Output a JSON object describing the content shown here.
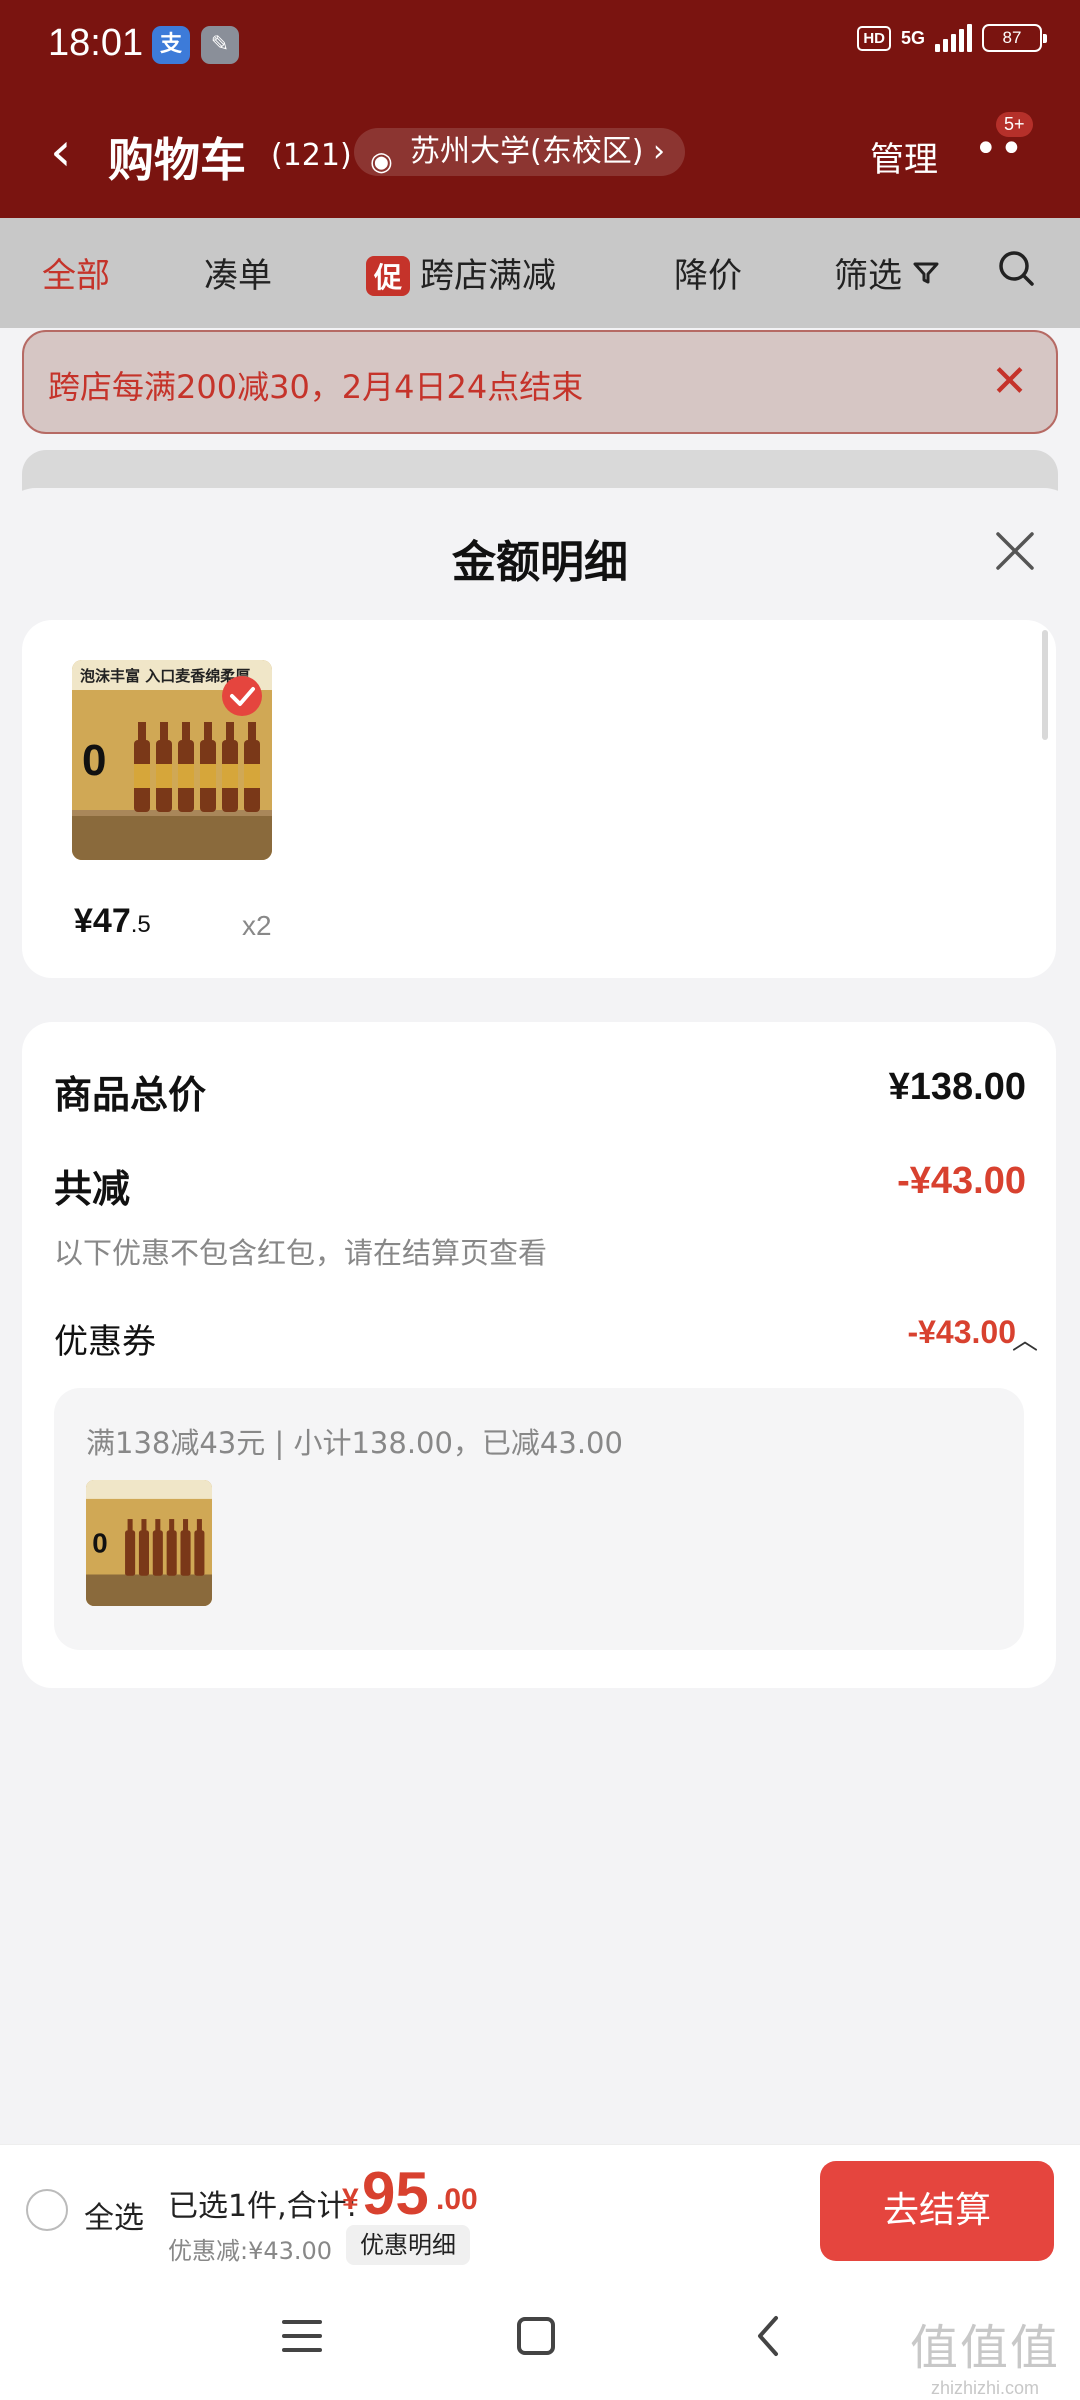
{
  "status_bar": {
    "time": "18:01",
    "network": "5G",
    "hd": "HD",
    "battery": "87"
  },
  "nav": {
    "title": "购物车",
    "count": "(121)",
    "address": "苏州大学(东校区)",
    "manage": "管理",
    "badge": "5+"
  },
  "tabs": [
    {
      "label": "全部"
    },
    {
      "label": "凑单"
    },
    {
      "label": "跨店满减",
      "badge": "促"
    },
    {
      "label": "降价"
    },
    {
      "label": "筛选"
    }
  ],
  "promo_banner": {
    "text": "跨店每满200减30，2月4日24点结束"
  },
  "sheet": {
    "title": "金额明细",
    "items": [
      {
        "image_caption": "泡沫丰富 入口麦香绵柔厚",
        "price_int": "¥47",
        "price_dec": ".5",
        "qty": "x2"
      }
    ],
    "summary": {
      "total_label": "商品总价",
      "total_value": "¥138.00",
      "reduce_label": "共减",
      "reduce_value": "-¥43.00",
      "reduce_note": "以下优惠不包含红包，请在结算页查看",
      "coupon_label": "优惠券",
      "coupon_value": "-¥43.00",
      "coupon_detail": "满138减43元 | 小计138.00，已减43.00"
    }
  },
  "checkout": {
    "select_all": "全选",
    "selected_text": "已选1件,合计:",
    "currency": "¥",
    "total_int": "95",
    "total_dec": ".00",
    "discount": "优惠减:¥43.00",
    "detail_button": "优惠明细",
    "checkout_button": "去结算"
  },
  "watermark": {
    "text": "zhizhizhi.com"
  },
  "colors": {
    "header": "#7a1410",
    "accent": "#d8412f",
    "checkout_button": "#e5453e"
  },
  "icons": [
    "back-chevron-icon",
    "eye-icon",
    "more-dots-icon",
    "filter-icon",
    "search-icon",
    "close-icon",
    "checkmark-icon",
    "chevron-up-icon",
    "menu-icon",
    "home-icon",
    "back-icon"
  ]
}
